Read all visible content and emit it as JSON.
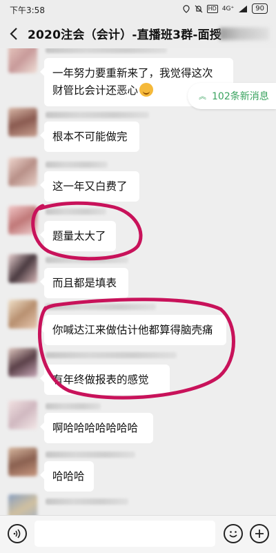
{
  "status": {
    "time": "下午3:58",
    "network": "4G⁺",
    "battery": "90",
    "icons": [
      "location-icon",
      "mute-icon",
      "hd-icon",
      "signal-icon",
      "battery-icon"
    ]
  },
  "header": {
    "title": "2020注会（会计）-直播班3群-面授",
    "back_icon": "back-arrow-icon"
  },
  "new_messages": {
    "label": "102条新消息",
    "color": "#3aa35f"
  },
  "messages": [
    {
      "text_line1": "一年努力要重新来了，我觉得这次",
      "text_line2": "财管比会计还恶心"
    },
    {
      "text": "根本不可能做完"
    },
    {
      "text": "这一年又白费了"
    },
    {
      "text": "题量太大了"
    },
    {
      "text": "而且都是填表"
    },
    {
      "text": "你喊达江来做估计他都算得脑壳痛"
    },
    {
      "text": "有年终做报表的感觉"
    },
    {
      "text": "啊哈哈哈哈哈哈哈"
    },
    {
      "text": "哈哈哈"
    }
  ],
  "annotation_color": "#c8125a",
  "input_bar": {
    "voice_icon": "voice-icon",
    "emoji_icon": "emoji-icon",
    "add_icon": "plus-icon"
  }
}
